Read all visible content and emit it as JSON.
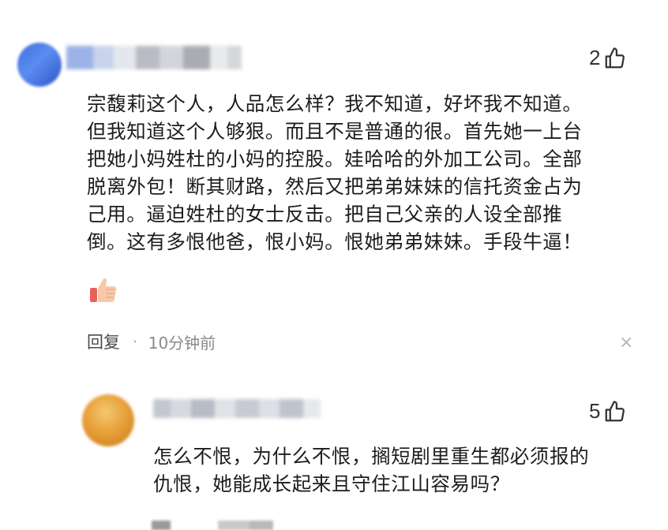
{
  "comments": [
    {
      "likes": "2",
      "lines": [
        "宗馥莉这个人，人品怎么样？我不知道，好坏我不知道。",
        "但我知道这个人够狠。而且不是普通的很。首先她一上台",
        "把她小妈姓杜的小妈的控股。娃哈哈的外加工公司。全部",
        "脱离外包！断其财路，然后又把弟弟妹妹的信托资金占为",
        "己用。逼迫姓杜的女士反击。把自己父亲的人设全部推",
        "倒。这有多恨他爸，恨小妈。恨她弟弟妹妹。手段牛逼！"
      ],
      "emoji": "thumbs-up-emoji",
      "reply_label": "回复",
      "separator": "·",
      "time": "10分钟前",
      "close_symbol": "×"
    },
    {
      "likes": "5",
      "lines": [
        "怎么不恨，为什么不恨，搁短剧里重生都必须报的",
        "仇恨，她能成长起来且守住江山容易吗？"
      ]
    }
  ],
  "icons": {
    "like": "thumbs-up-outline-icon",
    "close": "close-icon"
  },
  "colors": {
    "text": "#1c1c1c",
    "meta": "#8a8a8a",
    "avatar1": "#3f6fe0",
    "avatar2": "#e8a13a"
  }
}
